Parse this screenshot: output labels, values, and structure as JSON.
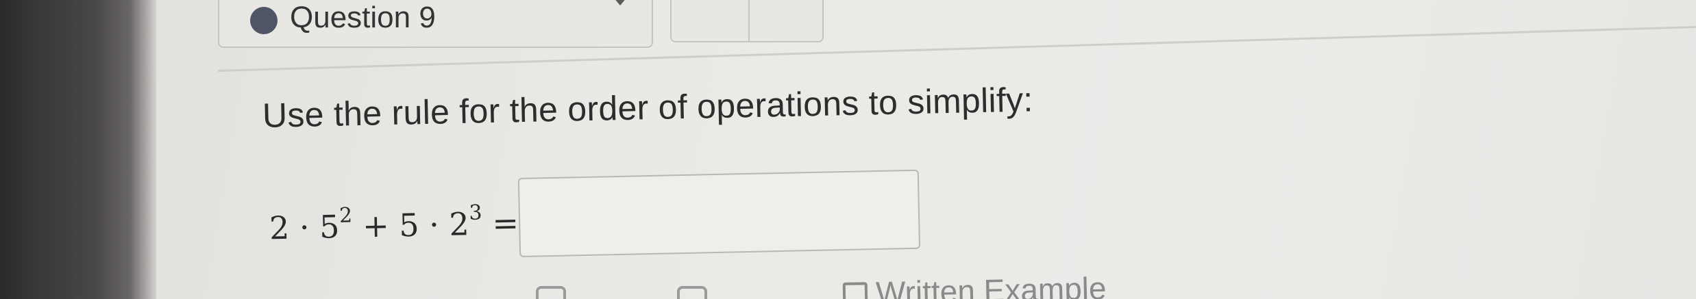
{
  "question": {
    "title": "Question 9",
    "status_color": "#4f5567"
  },
  "problem": {
    "instruction": "Use the rule for the order of operations to simplify:",
    "expression": {
      "a": "2",
      "dot": "·",
      "b": "5",
      "b_exp": "2",
      "plus": "+",
      "c": "5",
      "d": "2",
      "d_exp": "3",
      "equals": "="
    },
    "answer_value": ""
  },
  "help": {
    "example_label": "Written Example"
  },
  "icons": {
    "status": "status-dot-icon",
    "nav_chevron": "chevron-down-icon",
    "example": "document-icon"
  }
}
